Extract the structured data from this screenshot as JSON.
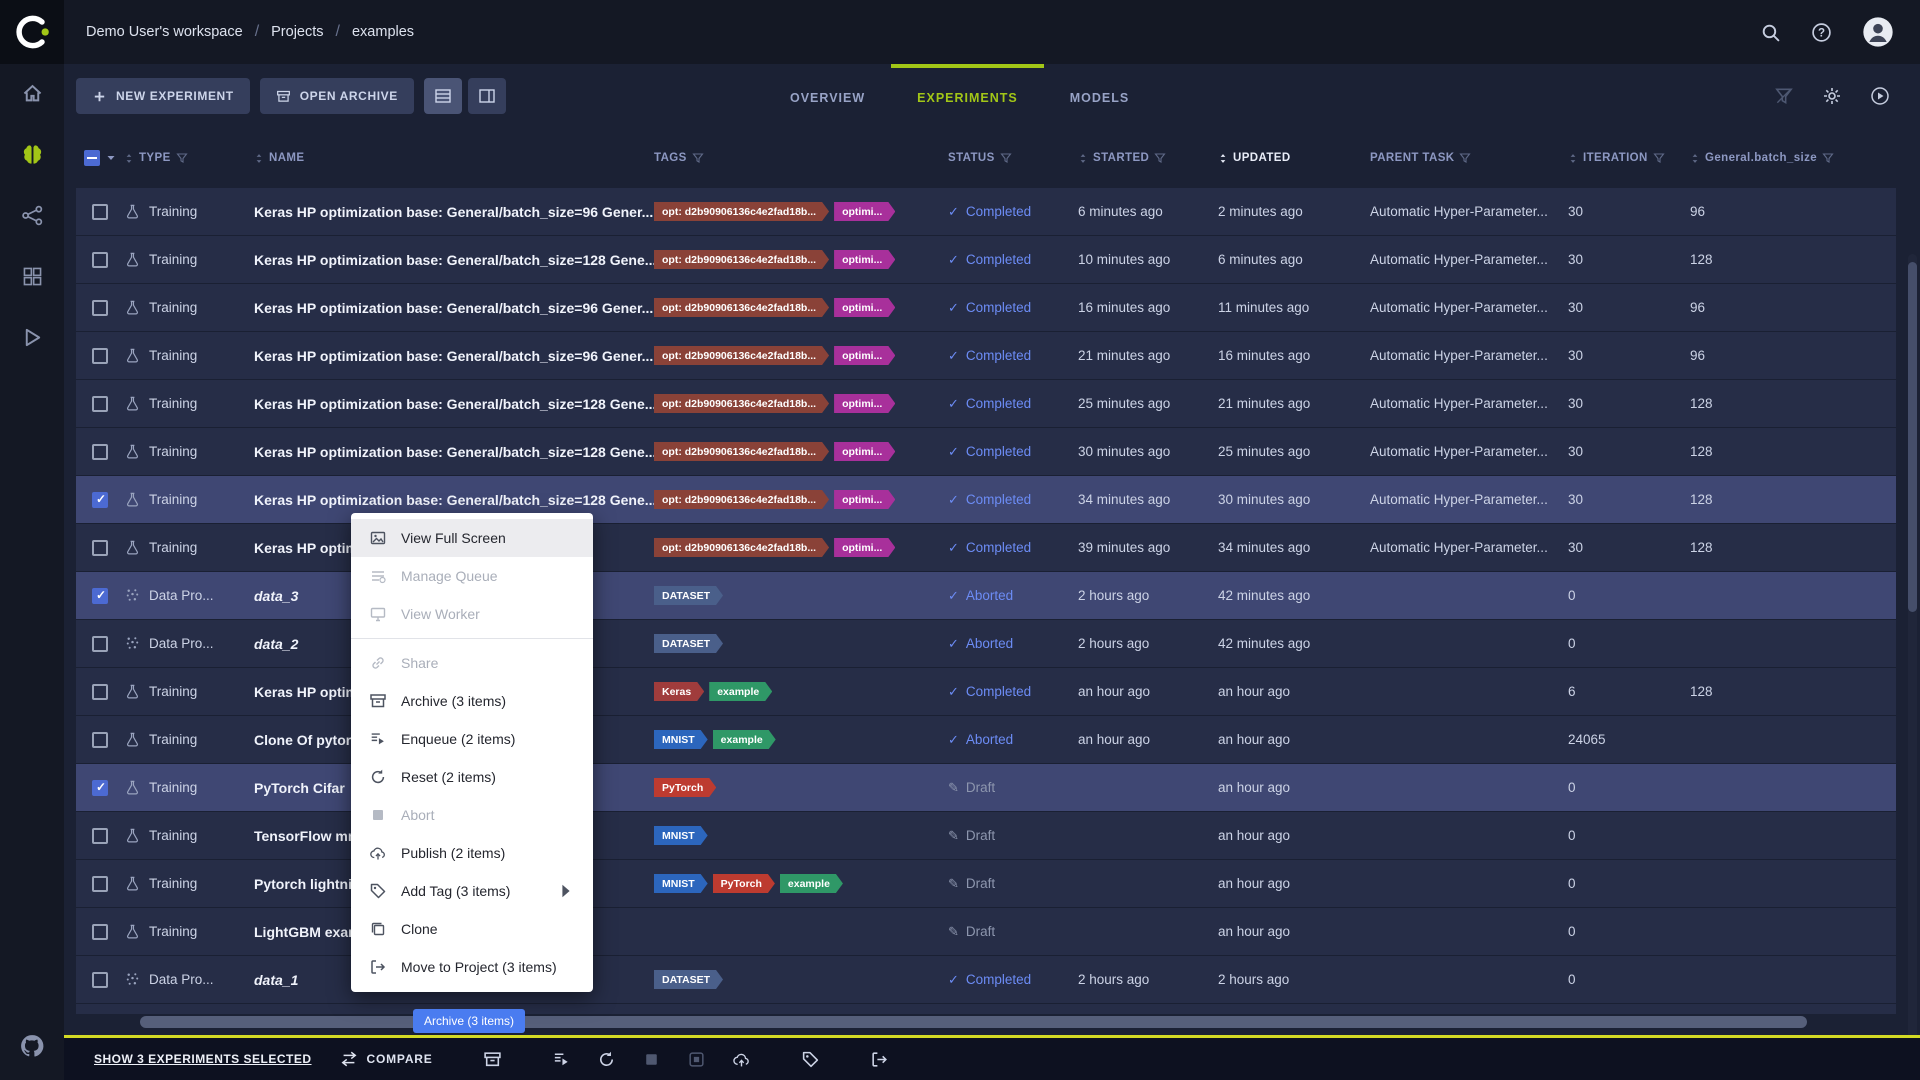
{
  "topbar": {
    "breadcrumbs": [
      "Demo User's workspace",
      "Projects",
      "examples"
    ]
  },
  "sidebar": {
    "items": [
      {
        "name": "home",
        "active": false
      },
      {
        "name": "projects",
        "active": true
      },
      {
        "name": "pipelines",
        "active": false
      },
      {
        "name": "datasets",
        "active": false
      },
      {
        "name": "reports",
        "active": false
      }
    ]
  },
  "toolbar": {
    "new_experiment_label": "NEW EXPERIMENT",
    "open_archive_label": "OPEN ARCHIVE",
    "tabs": [
      {
        "label": "OVERVIEW",
        "active": false
      },
      {
        "label": "EXPERIMENTS",
        "active": true
      },
      {
        "label": "MODELS",
        "active": false
      }
    ]
  },
  "table": {
    "header": {
      "type": "TYPE",
      "name": "NAME",
      "tags": "TAGS",
      "status": "STATUS",
      "started": "STARTED",
      "updated": "UPDATED",
      "parent": "PARENT TASK",
      "iteration": "ITERATION",
      "batch": "General.batch_size"
    },
    "rows": [
      {
        "checked": false,
        "selected": false,
        "type": "Training",
        "type_icon": "training",
        "name": "Keras HP optimization base: General/batch_size=96 Gener...",
        "italic": false,
        "tags": [
          {
            "label": "opt: d2b90906136c4e2fad18b...",
            "color": "#8a4238"
          },
          {
            "label": "optimi...",
            "color": "#a8309b"
          }
        ],
        "status": "Completed",
        "status_kind": "completed",
        "started": "6 minutes ago",
        "updated": "2 minutes ago",
        "parent": "Automatic Hyper-Parameter...",
        "iteration": "30",
        "batch": "96"
      },
      {
        "checked": false,
        "selected": false,
        "type": "Training",
        "type_icon": "training",
        "name": "Keras HP optimization base: General/batch_size=128 Gene...",
        "italic": false,
        "tags": [
          {
            "label": "opt: d2b90906136c4e2fad18b...",
            "color": "#8a4238"
          },
          {
            "label": "optimi...",
            "color": "#a8309b"
          }
        ],
        "status": "Completed",
        "status_kind": "completed",
        "started": "10 minutes ago",
        "updated": "6 minutes ago",
        "parent": "Automatic Hyper-Parameter...",
        "iteration": "30",
        "batch": "128"
      },
      {
        "checked": false,
        "selected": false,
        "type": "Training",
        "type_icon": "training",
        "name": "Keras HP optimization base: General/batch_size=96 Gener...",
        "italic": false,
        "tags": [
          {
            "label": "opt: d2b90906136c4e2fad18b...",
            "color": "#8a4238"
          },
          {
            "label": "optimi...",
            "color": "#a8309b"
          }
        ],
        "status": "Completed",
        "status_kind": "completed",
        "started": "16 minutes ago",
        "updated": "11 minutes ago",
        "parent": "Automatic Hyper-Parameter...",
        "iteration": "30",
        "batch": "96"
      },
      {
        "checked": false,
        "selected": false,
        "type": "Training",
        "type_icon": "training",
        "name": "Keras HP optimization base: General/batch_size=96 Gener...",
        "italic": false,
        "tags": [
          {
            "label": "opt: d2b90906136c4e2fad18b...",
            "color": "#8a4238"
          },
          {
            "label": "optimi...",
            "color": "#a8309b"
          }
        ],
        "status": "Completed",
        "status_kind": "completed",
        "started": "21 minutes ago",
        "updated": "16 minutes ago",
        "parent": "Automatic Hyper-Parameter...",
        "iteration": "30",
        "batch": "96"
      },
      {
        "checked": false,
        "selected": false,
        "type": "Training",
        "type_icon": "training",
        "name": "Keras HP optimization base: General/batch_size=128 Gene...",
        "italic": false,
        "tags": [
          {
            "label": "opt: d2b90906136c4e2fad18b...",
            "color": "#8a4238"
          },
          {
            "label": "optimi...",
            "color": "#a8309b"
          }
        ],
        "status": "Completed",
        "status_kind": "completed",
        "started": "25 minutes ago",
        "updated": "21 minutes ago",
        "parent": "Automatic Hyper-Parameter...",
        "iteration": "30",
        "batch": "128"
      },
      {
        "checked": false,
        "selected": false,
        "type": "Training",
        "type_icon": "training",
        "name": "Keras HP optimization base: General/batch_size=128 Gene...",
        "italic": false,
        "tags": [
          {
            "label": "opt: d2b90906136c4e2fad18b...",
            "color": "#8a4238"
          },
          {
            "label": "optimi...",
            "color": "#a8309b"
          }
        ],
        "status": "Completed",
        "status_kind": "completed",
        "started": "30 minutes ago",
        "updated": "25 minutes ago",
        "parent": "Automatic Hyper-Parameter...",
        "iteration": "30",
        "batch": "128"
      },
      {
        "checked": true,
        "selected": true,
        "type": "Training",
        "type_icon": "training",
        "name": "Keras HP optimization base: General/batch_size=128 Gene...",
        "italic": false,
        "tags": [
          {
            "label": "opt: d2b90906136c4e2fad18b...",
            "color": "#8a4238"
          },
          {
            "label": "optimi...",
            "color": "#a8309b"
          }
        ],
        "status": "Completed",
        "status_kind": "completed",
        "started": "34 minutes ago",
        "updated": "30 minutes ago",
        "parent": "Automatic Hyper-Parameter...",
        "iteration": "30",
        "batch": "128"
      },
      {
        "checked": false,
        "selected": false,
        "type": "Training",
        "type_icon": "training",
        "name": "Keras HP optim",
        "italic": false,
        "tags": [
          {
            "label": "opt: d2b90906136c4e2fad18b...",
            "color": "#8a4238"
          },
          {
            "label": "optimi...",
            "color": "#a8309b"
          }
        ],
        "status": "Completed",
        "status_kind": "completed",
        "started": "39 minutes ago",
        "updated": "34 minutes ago",
        "parent": "Automatic Hyper-Parameter...",
        "iteration": "30",
        "batch": "128"
      },
      {
        "checked": true,
        "selected": true,
        "type": "Data Pro...",
        "type_icon": "data",
        "name": "data_3",
        "italic": true,
        "tags": [
          {
            "label": "DATASET",
            "color": "#4a5f8a"
          }
        ],
        "status": "Aborted",
        "status_kind": "aborted",
        "started": "2 hours ago",
        "updated": "42 minutes ago",
        "parent": "",
        "iteration": "0",
        "batch": ""
      },
      {
        "checked": false,
        "selected": false,
        "type": "Data Pro...",
        "type_icon": "data",
        "name": "data_2",
        "italic": true,
        "tags": [
          {
            "label": "DATASET",
            "color": "#4a5f8a"
          }
        ],
        "status": "Aborted",
        "status_kind": "aborted",
        "started": "2 hours ago",
        "updated": "42 minutes ago",
        "parent": "",
        "iteration": "0",
        "batch": ""
      },
      {
        "checked": false,
        "selected": false,
        "type": "Training",
        "type_icon": "training",
        "name": "Keras HP optim",
        "italic": false,
        "tags": [
          {
            "label": "Keras",
            "color": "#a03c3c"
          },
          {
            "label": "example",
            "color": "#2f9867"
          }
        ],
        "status": "Completed",
        "status_kind": "completed",
        "started": "an hour ago",
        "updated": "an hour ago",
        "parent": "",
        "iteration": "6",
        "batch": "128"
      },
      {
        "checked": false,
        "selected": false,
        "type": "Training",
        "type_icon": "training",
        "name": "Clone Of pytorch",
        "italic": false,
        "tags": [
          {
            "label": "MNIST",
            "color": "#2c66bd"
          },
          {
            "label": "example",
            "color": "#2f9867"
          }
        ],
        "status": "Aborted",
        "status_kind": "aborted",
        "started": "an hour ago",
        "updated": "an hour ago",
        "parent": "",
        "iteration": "24065",
        "batch": ""
      },
      {
        "checked": true,
        "selected": true,
        "type": "Training",
        "type_icon": "training",
        "name": "PyTorch Cifar",
        "italic": false,
        "tags": [
          {
            "label": "PyTorch",
            "color": "#bd3b30"
          }
        ],
        "status": "Draft",
        "status_kind": "draft",
        "started": "",
        "updated": "an hour ago",
        "parent": "",
        "iteration": "0",
        "batch": ""
      },
      {
        "checked": false,
        "selected": false,
        "type": "Training",
        "type_icon": "training",
        "name": "TensorFlow mni",
        "italic": false,
        "tags": [
          {
            "label": "MNIST",
            "color": "#2c66bd"
          }
        ],
        "status": "Draft",
        "status_kind": "draft",
        "started": "",
        "updated": "an hour ago",
        "parent": "",
        "iteration": "0",
        "batch": ""
      },
      {
        "checked": false,
        "selected": false,
        "type": "Training",
        "type_icon": "training",
        "name": "Pytorch lightnin",
        "italic": false,
        "tags": [
          {
            "label": "MNIST",
            "color": "#2c66bd"
          },
          {
            "label": "PyTorch",
            "color": "#bd3b30"
          },
          {
            "label": "example",
            "color": "#2f9867"
          }
        ],
        "status": "Draft",
        "status_kind": "draft",
        "started": "",
        "updated": "an hour ago",
        "parent": "",
        "iteration": "0",
        "batch": ""
      },
      {
        "checked": false,
        "selected": false,
        "type": "Training",
        "type_icon": "training",
        "name": "LightGBM exam",
        "italic": false,
        "tags": [],
        "status": "Draft",
        "status_kind": "draft",
        "started": "",
        "updated": "an hour ago",
        "parent": "",
        "iteration": "0",
        "batch": ""
      },
      {
        "checked": false,
        "selected": false,
        "type": "Data Pro...",
        "type_icon": "data",
        "name": "data_1",
        "italic": true,
        "tags": [
          {
            "label": "DATASET",
            "color": "#4a5f8a"
          }
        ],
        "status": "Completed",
        "status_kind": "completed",
        "started": "2 hours ago",
        "updated": "2 hours ago",
        "parent": "",
        "iteration": "0",
        "batch": ""
      }
    ]
  },
  "context_menu": {
    "items": [
      {
        "label": "View Full Screen",
        "icon": "fullscreen",
        "disabled": false,
        "highlighted": true,
        "submenu": false,
        "divider_after": false
      },
      {
        "label": "Manage Queue",
        "icon": "queue",
        "disabled": true,
        "highlighted": false,
        "submenu": false,
        "divider_after": false
      },
      {
        "label": "View Worker",
        "icon": "worker",
        "disabled": true,
        "highlighted": false,
        "submenu": false,
        "divider_after": true
      },
      {
        "label": "Share",
        "icon": "share",
        "disabled": true,
        "highlighted": false,
        "submenu": false,
        "divider_after": false
      },
      {
        "label": "Archive (3 items)",
        "icon": "archive",
        "disabled": false,
        "highlighted": false,
        "submenu": false,
        "divider_after": false
      },
      {
        "label": "Enqueue (2 items)",
        "icon": "enqueue",
        "disabled": false,
        "highlighted": false,
        "submenu": false,
        "divider_after": false
      },
      {
        "label": "Reset (2 items)",
        "icon": "reset",
        "disabled": false,
        "highlighted": false,
        "submenu": false,
        "divider_after": false
      },
      {
        "label": "Abort",
        "icon": "abort",
        "disabled": true,
        "highlighted": false,
        "submenu": false,
        "divider_after": false
      },
      {
        "label": "Publish (2 items)",
        "icon": "publish",
        "disabled": false,
        "highlighted": false,
        "submenu": false,
        "divider_after": false
      },
      {
        "label": "Add Tag (3 items)",
        "icon": "tag",
        "disabled": false,
        "highlighted": false,
        "submenu": true,
        "divider_after": false
      },
      {
        "label": "Clone",
        "icon": "clone",
        "disabled": false,
        "highlighted": false,
        "submenu": false,
        "divider_after": false
      },
      {
        "label": "Move to Project (3 items)",
        "icon": "move",
        "disabled": false,
        "highlighted": false,
        "submenu": false,
        "divider_after": false
      }
    ]
  },
  "tooltip": {
    "text": "Archive (3 items)"
  },
  "footer": {
    "selected_label": "SHOW 3 EXPERIMENTS SELECTED",
    "compare_label": "COMPARE"
  },
  "colors": {
    "accent_green": "#a2c617",
    "status_blue": "#6c8cf5",
    "selection_blue": "#4c6ad2",
    "footer_accent_line": "#d3da25"
  }
}
